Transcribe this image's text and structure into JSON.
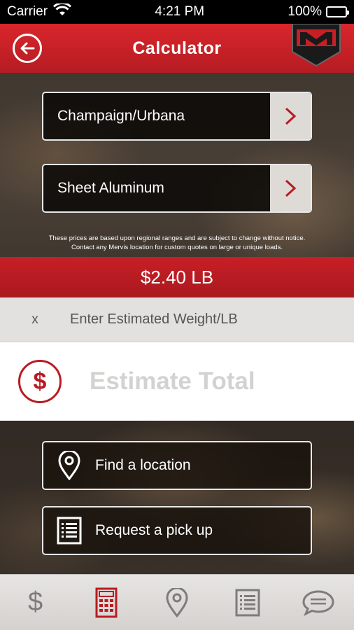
{
  "status_bar": {
    "carrier": "Carrier",
    "time": "4:21 PM",
    "battery": "100%"
  },
  "header": {
    "title": "Calculator",
    "logo_text": "M"
  },
  "selectors": {
    "location": "Champaign/Urbana",
    "material": "Sheet Aluminum"
  },
  "disclaimer": {
    "line1": "These prices are based upon regional ranges and are subject to change without notice.",
    "line2": "Contact any Mervis location for custom quotes on large or unique loads."
  },
  "price": "$2.40 LB",
  "weight": {
    "multiplier": "x",
    "placeholder": "Enter Estimated Weight/LB",
    "value": ""
  },
  "estimate": {
    "symbol": "$",
    "label": "Estimate Total"
  },
  "actions": {
    "find_location": "Find a location",
    "request_pickup": "Request a pick up"
  },
  "tabs": {
    "prices_symbol": "$",
    "active": "calculator"
  },
  "colors": {
    "brand_red": "#c81f26",
    "tab_active": "#b81c22",
    "tab_inactive": "#7c7c7c"
  },
  "icons": [
    "back-arrow-icon",
    "wifi-icon",
    "battery-icon",
    "chevron-right-icon",
    "dollar-icon",
    "map-pin-icon",
    "list-icon",
    "calculator-icon",
    "chat-icon"
  ]
}
